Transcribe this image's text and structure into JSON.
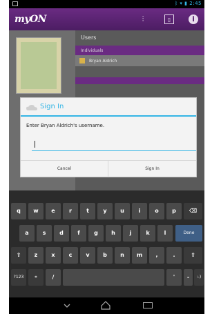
{
  "status_bar": {
    "time": "2:45",
    "icons": [
      "bluetooth-icon",
      "wifi-icon",
      "battery-icon"
    ]
  },
  "app": {
    "logo": "myON",
    "header_icons": [
      "equalizer-icon",
      "bookmark-icon",
      "info-icon"
    ]
  },
  "background": {
    "users_title": "Users",
    "individuals_label": "Individuals",
    "user_name": "Bryan Aldrich"
  },
  "dialog": {
    "title": "Sign In",
    "message": "Enter Bryan Aldrich's username.",
    "input_value": "",
    "cancel_label": "Cancel",
    "signin_label": "Sign In"
  },
  "keyboard": {
    "row1": [
      "q",
      "w",
      "e",
      "r",
      "t",
      "y",
      "u",
      "i",
      "o",
      "p",
      "⌫"
    ],
    "row2": [
      "a",
      "s",
      "d",
      "f",
      "g",
      "h",
      "j",
      "k",
      "l",
      "Done"
    ],
    "row3": [
      "⇧",
      "z",
      "x",
      "c",
      "v",
      "b",
      "n",
      "m",
      ",",
      ".",
      "⇧"
    ],
    "row4": [
      "?123",
      "⌗",
      "/",
      "",
      "'",
      "-",
      ":-)"
    ]
  },
  "colors": {
    "accent": "#33b5e5",
    "brand": "#6a2b82"
  }
}
